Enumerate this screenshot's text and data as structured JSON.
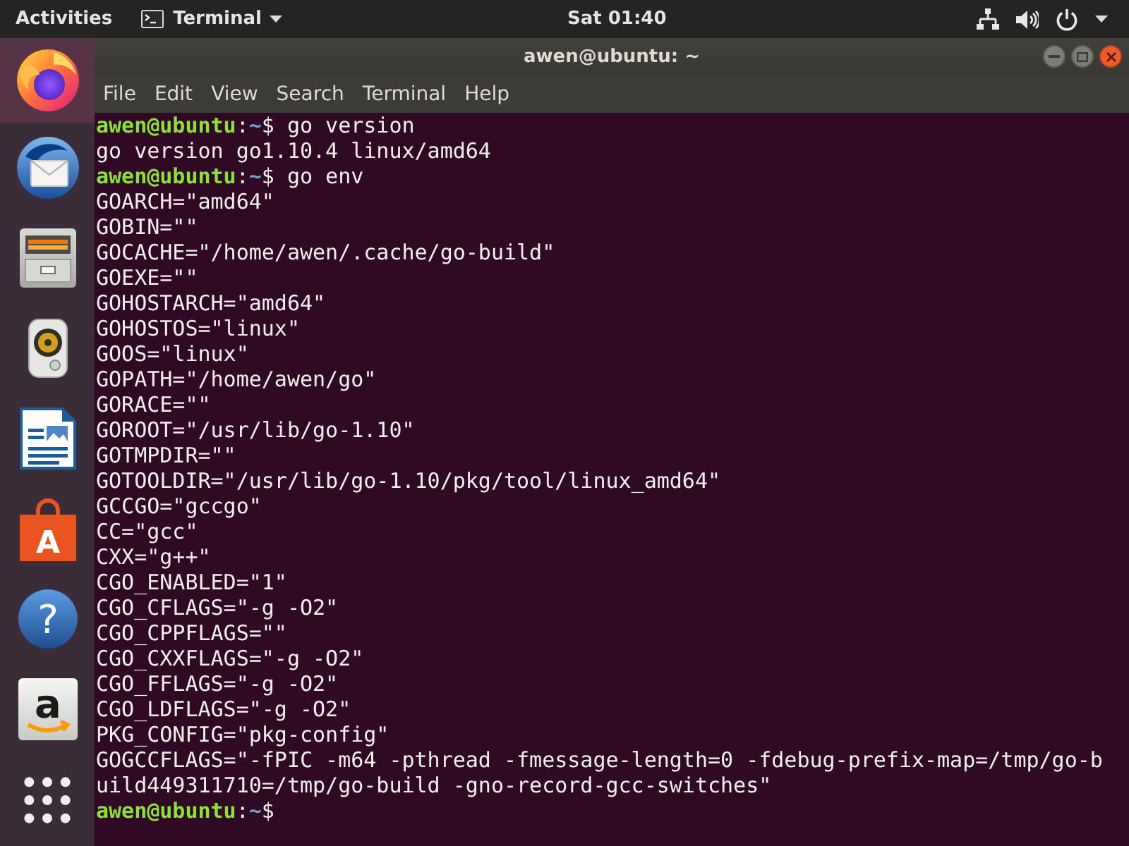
{
  "top_bar": {
    "activities": "Activities",
    "app_menu": "Terminal",
    "clock": "Sat 01:40"
  },
  "dock": [
    {
      "kind": "browser",
      "selected": true
    },
    {
      "kind": "mail",
      "selected": false
    },
    {
      "kind": "files",
      "selected": false
    },
    {
      "kind": "music",
      "selected": false
    },
    {
      "kind": "writer",
      "selected": false
    },
    {
      "kind": "store",
      "glyph": "A",
      "selected": false
    },
    {
      "kind": "help",
      "glyph": "?",
      "selected": false
    },
    {
      "kind": "shop",
      "glyph": "a",
      "selected": false
    },
    {
      "kind": "apps",
      "selected": false
    }
  ],
  "window": {
    "title": "awen@ubuntu: ~",
    "menu": [
      "File",
      "Edit",
      "View",
      "Search",
      "Terminal",
      "Help"
    ],
    "lines": [
      {
        "kind": "prompt",
        "user": "awen@ubuntu",
        "separator": ":",
        "dir": "~",
        "command": "$ go version"
      },
      {
        "kind": "output",
        "text": "go version go1.10.4 linux/amd64"
      },
      {
        "kind": "prompt",
        "user": "awen@ubuntu",
        "separator": ":",
        "dir": "~",
        "command": "$ go env"
      },
      {
        "kind": "output",
        "text": "GOARCH=\"amd64\""
      },
      {
        "kind": "output",
        "text": "GOBIN=\"\""
      },
      {
        "kind": "output",
        "text": "GOCACHE=\"/home/awen/.cache/go-build\""
      },
      {
        "kind": "output",
        "text": "GOEXE=\"\""
      },
      {
        "kind": "output",
        "text": "GOHOSTARCH=\"amd64\""
      },
      {
        "kind": "output",
        "text": "GOHOSTOS=\"linux\""
      },
      {
        "kind": "output",
        "text": "GOOS=\"linux\""
      },
      {
        "kind": "output",
        "text": "GOPATH=\"/home/awen/go\""
      },
      {
        "kind": "output",
        "text": "GORACE=\"\""
      },
      {
        "kind": "output",
        "text": "GOROOT=\"/usr/lib/go-1.10\""
      },
      {
        "kind": "output",
        "text": "GOTMPDIR=\"\""
      },
      {
        "kind": "output",
        "text": "GOTOOLDIR=\"/usr/lib/go-1.10/pkg/tool/linux_amd64\""
      },
      {
        "kind": "output",
        "text": "GCCGO=\"gccgo\""
      },
      {
        "kind": "output",
        "text": "CC=\"gcc\""
      },
      {
        "kind": "output",
        "text": "CXX=\"g++\""
      },
      {
        "kind": "output",
        "text": "CGO_ENABLED=\"1\""
      },
      {
        "kind": "output",
        "text": "CGO_CFLAGS=\"-g -O2\""
      },
      {
        "kind": "output",
        "text": "CGO_CPPFLAGS=\"\""
      },
      {
        "kind": "output",
        "text": "CGO_CXXFLAGS=\"-g -O2\""
      },
      {
        "kind": "output",
        "text": "CGO_FFLAGS=\"-g -O2\""
      },
      {
        "kind": "output",
        "text": "CGO_LDFLAGS=\"-g -O2\""
      },
      {
        "kind": "output",
        "text": "PKG_CONFIG=\"pkg-config\""
      },
      {
        "kind": "output",
        "text": "GOGCCFLAGS=\"-fPIC -m64 -pthread -fmessage-length=0 -fdebug-prefix-map=/tmp/go-build449311710=/tmp/go-build -gno-record-gcc-switches\""
      },
      {
        "kind": "prompt",
        "user": "awen@ubuntu",
        "separator": ":",
        "dir": "~",
        "command": "$"
      }
    ]
  }
}
